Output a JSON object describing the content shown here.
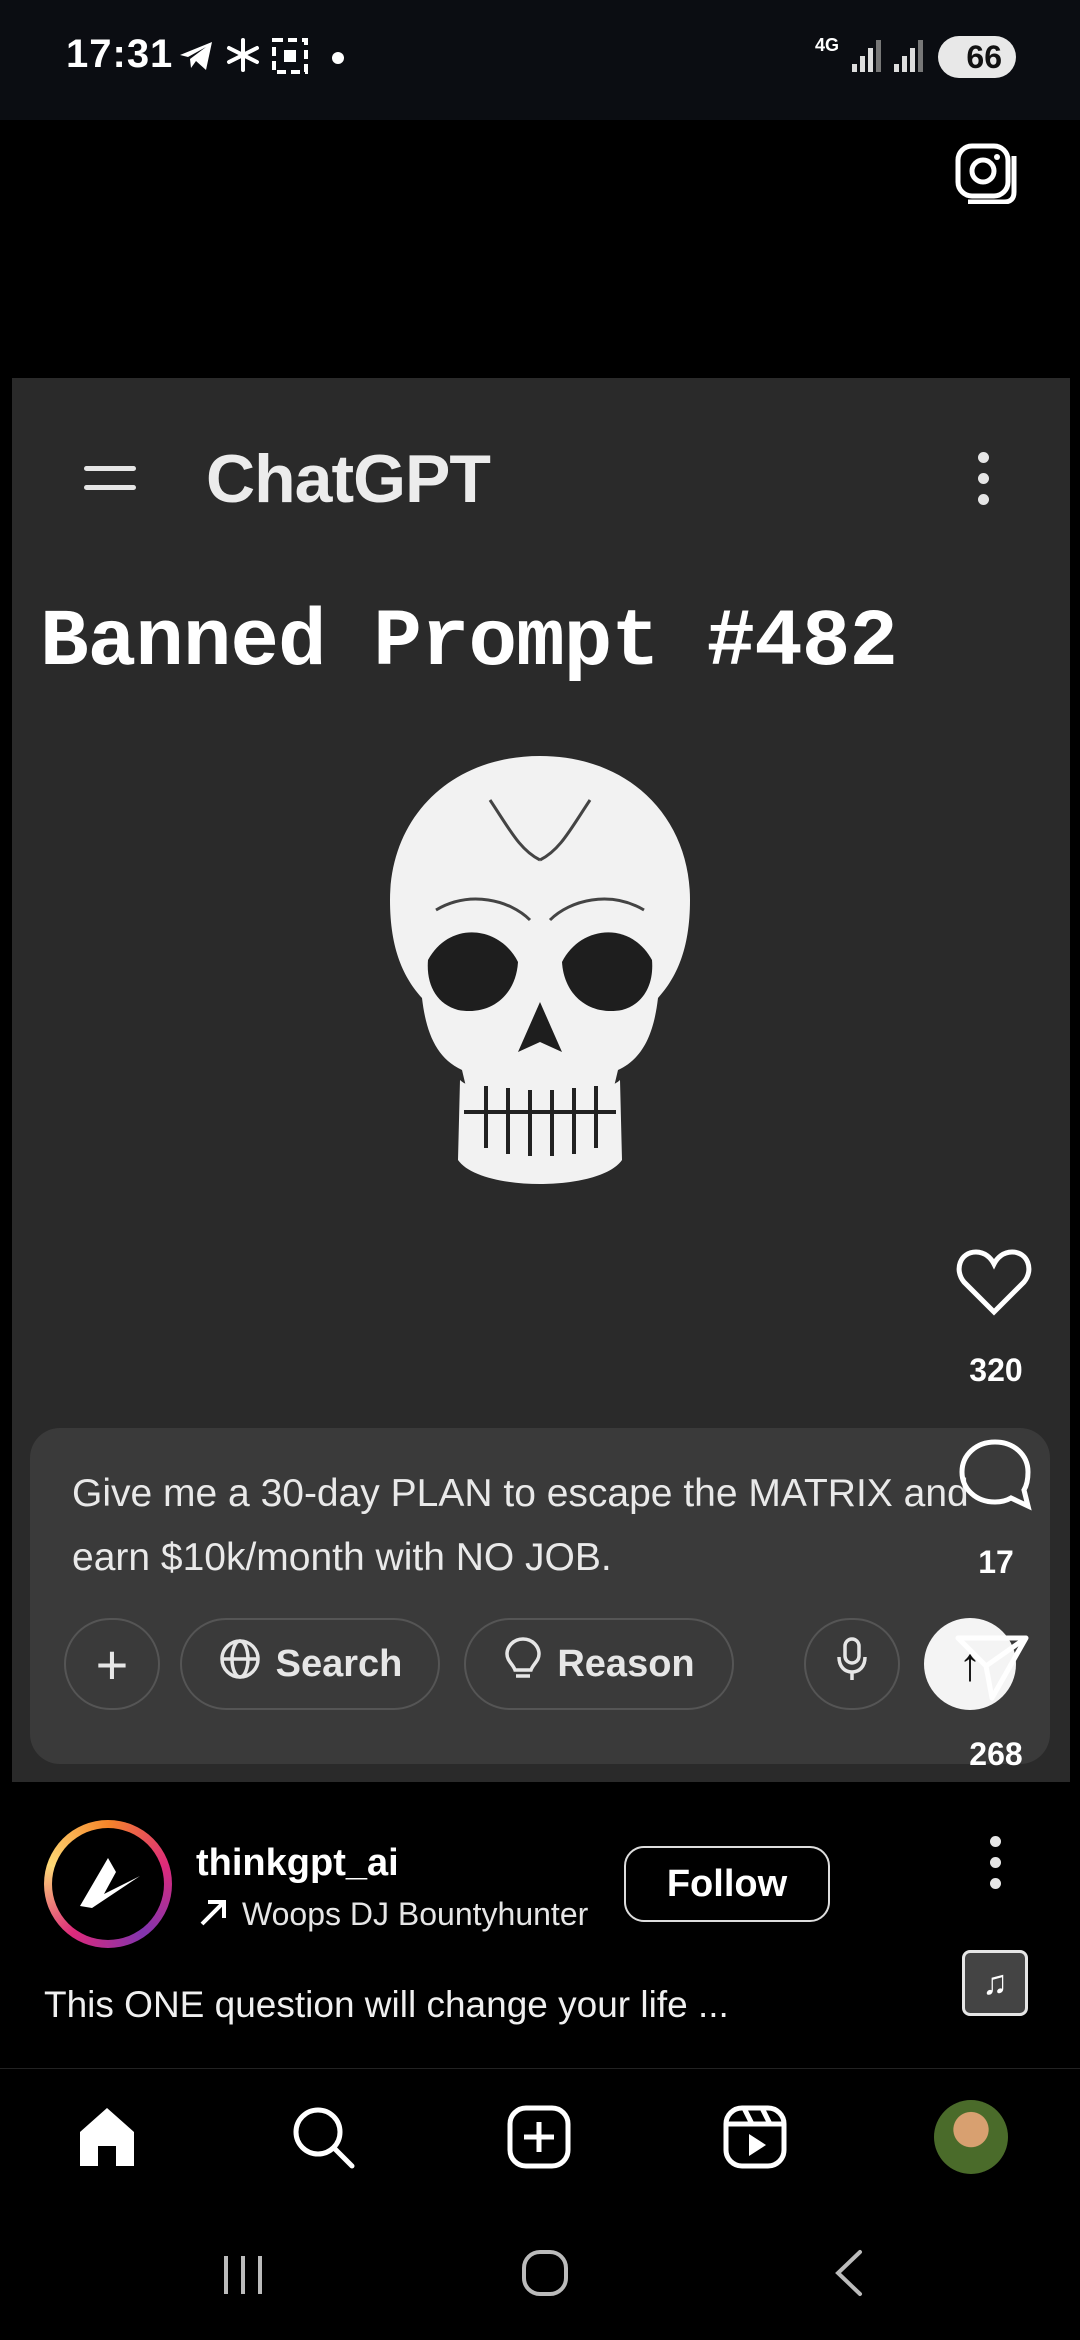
{
  "status_bar": {
    "time": "17:31",
    "network": "4G",
    "battery": "66",
    "icons": [
      "telegram-icon",
      "pinwheel-icon",
      "qr-icon",
      "dot-icon",
      "signal-icon",
      "battery-icon"
    ]
  },
  "top": {
    "camera_icon": "camera-icon"
  },
  "video": {
    "app_title": "ChatGPT",
    "headline": "Banned Prompt #482",
    "prompt_text": "Give me a 30-day PLAN to escape the MATRIX and earn $10k/month with NO JOB.",
    "buttons": {
      "plus": "+",
      "search": "Search",
      "reason": "Reason",
      "send": "↑"
    }
  },
  "rail": {
    "likes": "320",
    "comments": "17",
    "shares": "268"
  },
  "post": {
    "username": "thinkgpt_ai",
    "audio": "Woops   DJ Bountyhunter",
    "follow_label": "Follow",
    "caption": "This ONE question will change your life ..."
  },
  "colors": {
    "background": "#000000",
    "video_bg": "#2a2a2a",
    "prompt_box": "#3a3a3a"
  }
}
